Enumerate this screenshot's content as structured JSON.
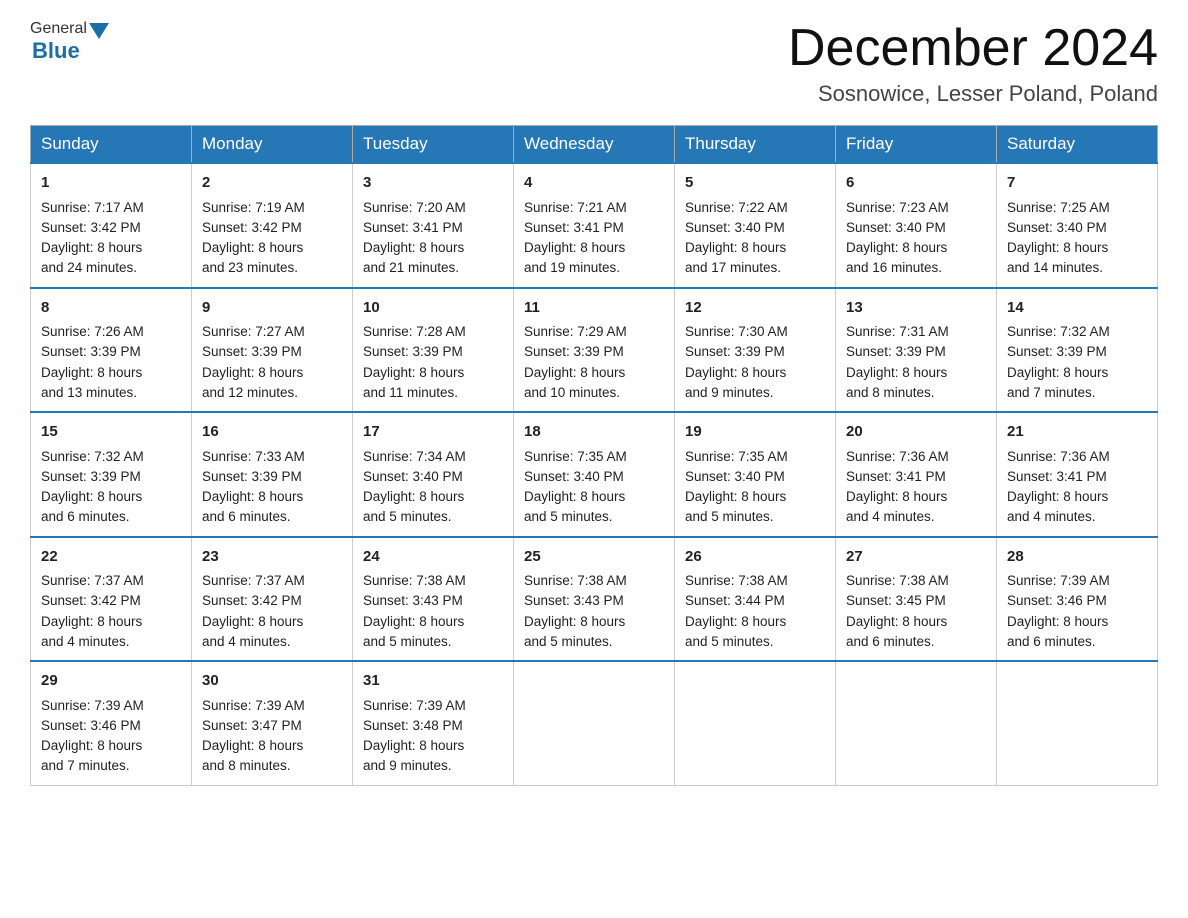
{
  "header": {
    "logo": {
      "general": "General",
      "blue": "Blue"
    },
    "title": "December 2024",
    "location": "Sosnowice, Lesser Poland, Poland"
  },
  "calendar": {
    "days_of_week": [
      "Sunday",
      "Monday",
      "Tuesday",
      "Wednesday",
      "Thursday",
      "Friday",
      "Saturday"
    ],
    "weeks": [
      [
        {
          "day": "1",
          "sunrise": "7:17 AM",
          "sunset": "3:42 PM",
          "daylight": "8 hours and 24 minutes."
        },
        {
          "day": "2",
          "sunrise": "7:19 AM",
          "sunset": "3:42 PM",
          "daylight": "8 hours and 23 minutes."
        },
        {
          "day": "3",
          "sunrise": "7:20 AM",
          "sunset": "3:41 PM",
          "daylight": "8 hours and 21 minutes."
        },
        {
          "day": "4",
          "sunrise": "7:21 AM",
          "sunset": "3:41 PM",
          "daylight": "8 hours and 19 minutes."
        },
        {
          "day": "5",
          "sunrise": "7:22 AM",
          "sunset": "3:40 PM",
          "daylight": "8 hours and 17 minutes."
        },
        {
          "day": "6",
          "sunrise": "7:23 AM",
          "sunset": "3:40 PM",
          "daylight": "8 hours and 16 minutes."
        },
        {
          "day": "7",
          "sunrise": "7:25 AM",
          "sunset": "3:40 PM",
          "daylight": "8 hours and 14 minutes."
        }
      ],
      [
        {
          "day": "8",
          "sunrise": "7:26 AM",
          "sunset": "3:39 PM",
          "daylight": "8 hours and 13 minutes."
        },
        {
          "day": "9",
          "sunrise": "7:27 AM",
          "sunset": "3:39 PM",
          "daylight": "8 hours and 12 minutes."
        },
        {
          "day": "10",
          "sunrise": "7:28 AM",
          "sunset": "3:39 PM",
          "daylight": "8 hours and 11 minutes."
        },
        {
          "day": "11",
          "sunrise": "7:29 AM",
          "sunset": "3:39 PM",
          "daylight": "8 hours and 10 minutes."
        },
        {
          "day": "12",
          "sunrise": "7:30 AM",
          "sunset": "3:39 PM",
          "daylight": "8 hours and 9 minutes."
        },
        {
          "day": "13",
          "sunrise": "7:31 AM",
          "sunset": "3:39 PM",
          "daylight": "8 hours and 8 minutes."
        },
        {
          "day": "14",
          "sunrise": "7:32 AM",
          "sunset": "3:39 PM",
          "daylight": "8 hours and 7 minutes."
        }
      ],
      [
        {
          "day": "15",
          "sunrise": "7:32 AM",
          "sunset": "3:39 PM",
          "daylight": "8 hours and 6 minutes."
        },
        {
          "day": "16",
          "sunrise": "7:33 AM",
          "sunset": "3:39 PM",
          "daylight": "8 hours and 6 minutes."
        },
        {
          "day": "17",
          "sunrise": "7:34 AM",
          "sunset": "3:40 PM",
          "daylight": "8 hours and 5 minutes."
        },
        {
          "day": "18",
          "sunrise": "7:35 AM",
          "sunset": "3:40 PM",
          "daylight": "8 hours and 5 minutes."
        },
        {
          "day": "19",
          "sunrise": "7:35 AM",
          "sunset": "3:40 PM",
          "daylight": "8 hours and 5 minutes."
        },
        {
          "day": "20",
          "sunrise": "7:36 AM",
          "sunset": "3:41 PM",
          "daylight": "8 hours and 4 minutes."
        },
        {
          "day": "21",
          "sunrise": "7:36 AM",
          "sunset": "3:41 PM",
          "daylight": "8 hours and 4 minutes."
        }
      ],
      [
        {
          "day": "22",
          "sunrise": "7:37 AM",
          "sunset": "3:42 PM",
          "daylight": "8 hours and 4 minutes."
        },
        {
          "day": "23",
          "sunrise": "7:37 AM",
          "sunset": "3:42 PM",
          "daylight": "8 hours and 4 minutes."
        },
        {
          "day": "24",
          "sunrise": "7:38 AM",
          "sunset": "3:43 PM",
          "daylight": "8 hours and 5 minutes."
        },
        {
          "day": "25",
          "sunrise": "7:38 AM",
          "sunset": "3:43 PM",
          "daylight": "8 hours and 5 minutes."
        },
        {
          "day": "26",
          "sunrise": "7:38 AM",
          "sunset": "3:44 PM",
          "daylight": "8 hours and 5 minutes."
        },
        {
          "day": "27",
          "sunrise": "7:38 AM",
          "sunset": "3:45 PM",
          "daylight": "8 hours and 6 minutes."
        },
        {
          "day": "28",
          "sunrise": "7:39 AM",
          "sunset": "3:46 PM",
          "daylight": "8 hours and 6 minutes."
        }
      ],
      [
        {
          "day": "29",
          "sunrise": "7:39 AM",
          "sunset": "3:46 PM",
          "daylight": "8 hours and 7 minutes."
        },
        {
          "day": "30",
          "sunrise": "7:39 AM",
          "sunset": "3:47 PM",
          "daylight": "8 hours and 8 minutes."
        },
        {
          "day": "31",
          "sunrise": "7:39 AM",
          "sunset": "3:48 PM",
          "daylight": "8 hours and 9 minutes."
        },
        null,
        null,
        null,
        null
      ]
    ],
    "labels": {
      "sunrise": "Sunrise:",
      "sunset": "Sunset:",
      "daylight": "Daylight:"
    }
  }
}
